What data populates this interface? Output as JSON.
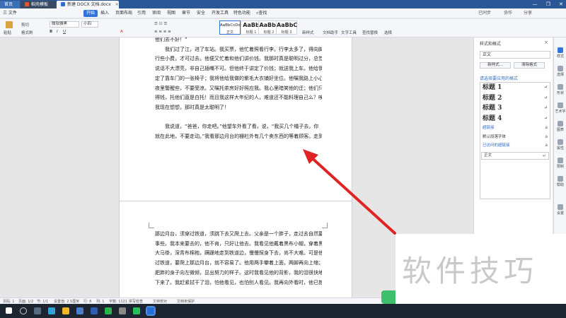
{
  "titlebar": {
    "tabs": [
      {
        "label": "首页"
      },
      {
        "label": "稻壳模板"
      },
      {
        "label": "新建 DOCX 文档.docx"
      }
    ],
    "controls": {
      "minimize": "—",
      "restore": "❐",
      "close": "✕"
    }
  },
  "menubar": {
    "file_label": "三 文件",
    "items": [
      "开始",
      "插入",
      "页面布局",
      "引用",
      "审阅",
      "视图",
      "章节",
      "安全",
      "开发工具",
      "特色功能"
    ],
    "search_label": "查找",
    "right": {
      "sync": "已同步",
      "collab": "协作",
      "share": "分享"
    }
  },
  "ribbon": {
    "paste": "粘贴",
    "cut": "剪切",
    "format_painter": "格式刷",
    "font_name": "微软雅黑",
    "font_size": "小四",
    "styles": [
      {
        "preview": "AaBbCcDd",
        "name": "正文"
      },
      {
        "preview": "AaBb",
        "name": "标题 1"
      },
      {
        "preview": "AaBb(",
        "name": "标题 2"
      },
      {
        "preview": "AaBbC",
        "name": "标题 3"
      }
    ],
    "new_style": "新样式",
    "doc_helper": "文档助手",
    "text_tools": "文字工具",
    "find_replace": "查找替换",
    "select": "选择"
  },
  "document": {
    "page1_lines": [
      "他们去不好！”",
      "我们过了江，进了车站。我买票，他忙着照看行李。行李太多了，得向脚夫",
      "行些小费，才可过去。他便又忙着和他们讲价钱。我那时真是聪明过分，总觉他",
      "说话不大漂亮，非自己插嘴不可。但他终于讲定了价钱；就送我上车。他给我拣",
      "定了靠车门的一张椅子；我将他给我做的紫毛大衣铺好坐位。他嘱我路上小心，",
      "夜里警醒些，不要受凉。又嘱托茶房好好照应我。我心里暗笑他的迂；他们只认",
      "得钱，托他们直是白托！而且我这样大年纪的人，难道还不能料理自己么？唉，",
      "我现在想想，那时真是太聪明了！",
      "",
      "我说道，“爸爸，你走吧。”他望车外看了看，说，“我买几个橘子去。你",
      "就在此地，不要走动。”我看那边月台的栅栏外有几个卖东西的等着顾客。走到"
    ],
    "page2_lines": [
      "那边月台，须穿过铁道，须跳下去又爬上去。父亲是一个胖子，走过去自然要费",
      "事些。我本来要去的，他不肯，只好让他去。我看见他戴着黑布小帽，穿着黑布",
      "大马褂，深青布棉袍，蹒跚地走到铁道边，慢慢探身下去，尚不大难。可是他穿",
      "过铁道，要爬上那边月台，就不容易了。他用两手攀着上面，两脚再向上缩；他",
      "肥胖的身子向左微倾，显出努力的样子。这时我看见他的背影，我的泪很快地流",
      "下来了。我赶紧拭干了泪，怕他看见，也怕别人看见。我再向外看时，他已抱了"
    ]
  },
  "pane": {
    "title": "样式和格式",
    "current_style": "正文",
    "new_style_btn": "新样式...",
    "clear_format_btn": "清除格式",
    "apply_heading": "请选择要应用的格式",
    "style_items": [
      {
        "label": "标题  1",
        "kind": "heading"
      },
      {
        "label": "标题  2",
        "kind": "heading"
      },
      {
        "label": "标题  3",
        "kind": "heading"
      },
      {
        "label": "标题  4",
        "kind": "heading"
      },
      {
        "label": "超链接",
        "kind": "link"
      },
      {
        "label": "默认段落字体",
        "kind": "small"
      },
      {
        "label": "已访问的超链接",
        "kind": "link"
      },
      {
        "label": "正文",
        "kind": "boxed"
      }
    ]
  },
  "strip": {
    "items": [
      "样式",
      "选择",
      "形状",
      "艺术字",
      "图表",
      "属性",
      "限制",
      "帮助",
      "设置"
    ]
  },
  "status": {
    "page": "页码: 1",
    "pages": "页面: 1/2",
    "section": "节: 1/1",
    "position": "设置值: 2.5厘米",
    "row": "行: 6",
    "col": "列: 1",
    "words": "字数: 1121",
    "spell": "拼写检查",
    "doc_check": "文档校对",
    "protect": "文档未保护"
  },
  "watermark": "软件技巧",
  "colors": {
    "titlebar": "#2b5797",
    "accent": "#3173d8",
    "arrow": "#e02424",
    "watermark": "#c9c9c9"
  }
}
